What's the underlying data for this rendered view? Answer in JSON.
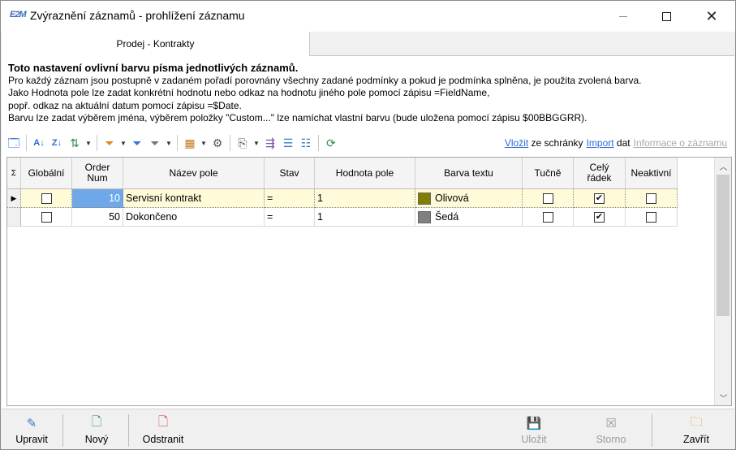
{
  "window": {
    "app_icon_text": "E2M",
    "title": "Zvýraznění záznamů - prohlížení záznamu"
  },
  "tab": {
    "label": "Prodej - Kontrakty"
  },
  "info": {
    "heading": "Toto nastavení ovlivní barvu písma jednotlivých záznamů.",
    "lines": [
      "Pro každý záznam jsou postupně v zadaném pořadí porovnány všechny zadané podmínky a pokud je podmínka splněna, je použita zvolená barva.",
      "Jako Hodnota pole lze zadat konkrétní hodnotu nebo odkaz na hodnotu jiného pole pomocí zápisu =FieldName,",
      "popř. odkaz na aktuální datum pomocí zápisu =$Date.",
      "Barvu lze zadat výběrem jména, výběrem položky \"Custom...\" lze namíchat vlastní barvu (bude uložena pomocí zápisu $00BBGGRR)."
    ]
  },
  "toolbar": {
    "paste_link": "Vložit",
    "paste_rest": "ze schránky",
    "import_link": "Import",
    "import_rest": "dat",
    "info_link": "Informace o záznamu"
  },
  "grid": {
    "headers": {
      "sigma": "Σ",
      "global": "Globální",
      "order": "Order Num",
      "field_name": "Název pole",
      "state": "Stav",
      "value": "Hodnota pole",
      "text_color": "Barva textu",
      "bold": "Tučně",
      "whole_row": "Celý řádek",
      "inactive": "Neaktivní"
    },
    "rows": [
      {
        "global": false,
        "order": "10",
        "field_name": "Servisní kontrakt",
        "state": "=",
        "value": "1",
        "color_name": "Olivová",
        "color_hex": "#808000",
        "bold": false,
        "whole_row": true,
        "inactive": false,
        "selected": true
      },
      {
        "global": false,
        "order": "50",
        "field_name": "Dokončeno",
        "state": "=",
        "value": "1",
        "color_name": "Šedá",
        "color_hex": "#808080",
        "bold": false,
        "whole_row": true,
        "inactive": false,
        "selected": false
      }
    ]
  },
  "bottom": {
    "edit": "Upravit",
    "new": "Nový",
    "delete": "Odstranit",
    "save": "Uložit",
    "cancel": "Storno",
    "close": "Zavřít"
  }
}
